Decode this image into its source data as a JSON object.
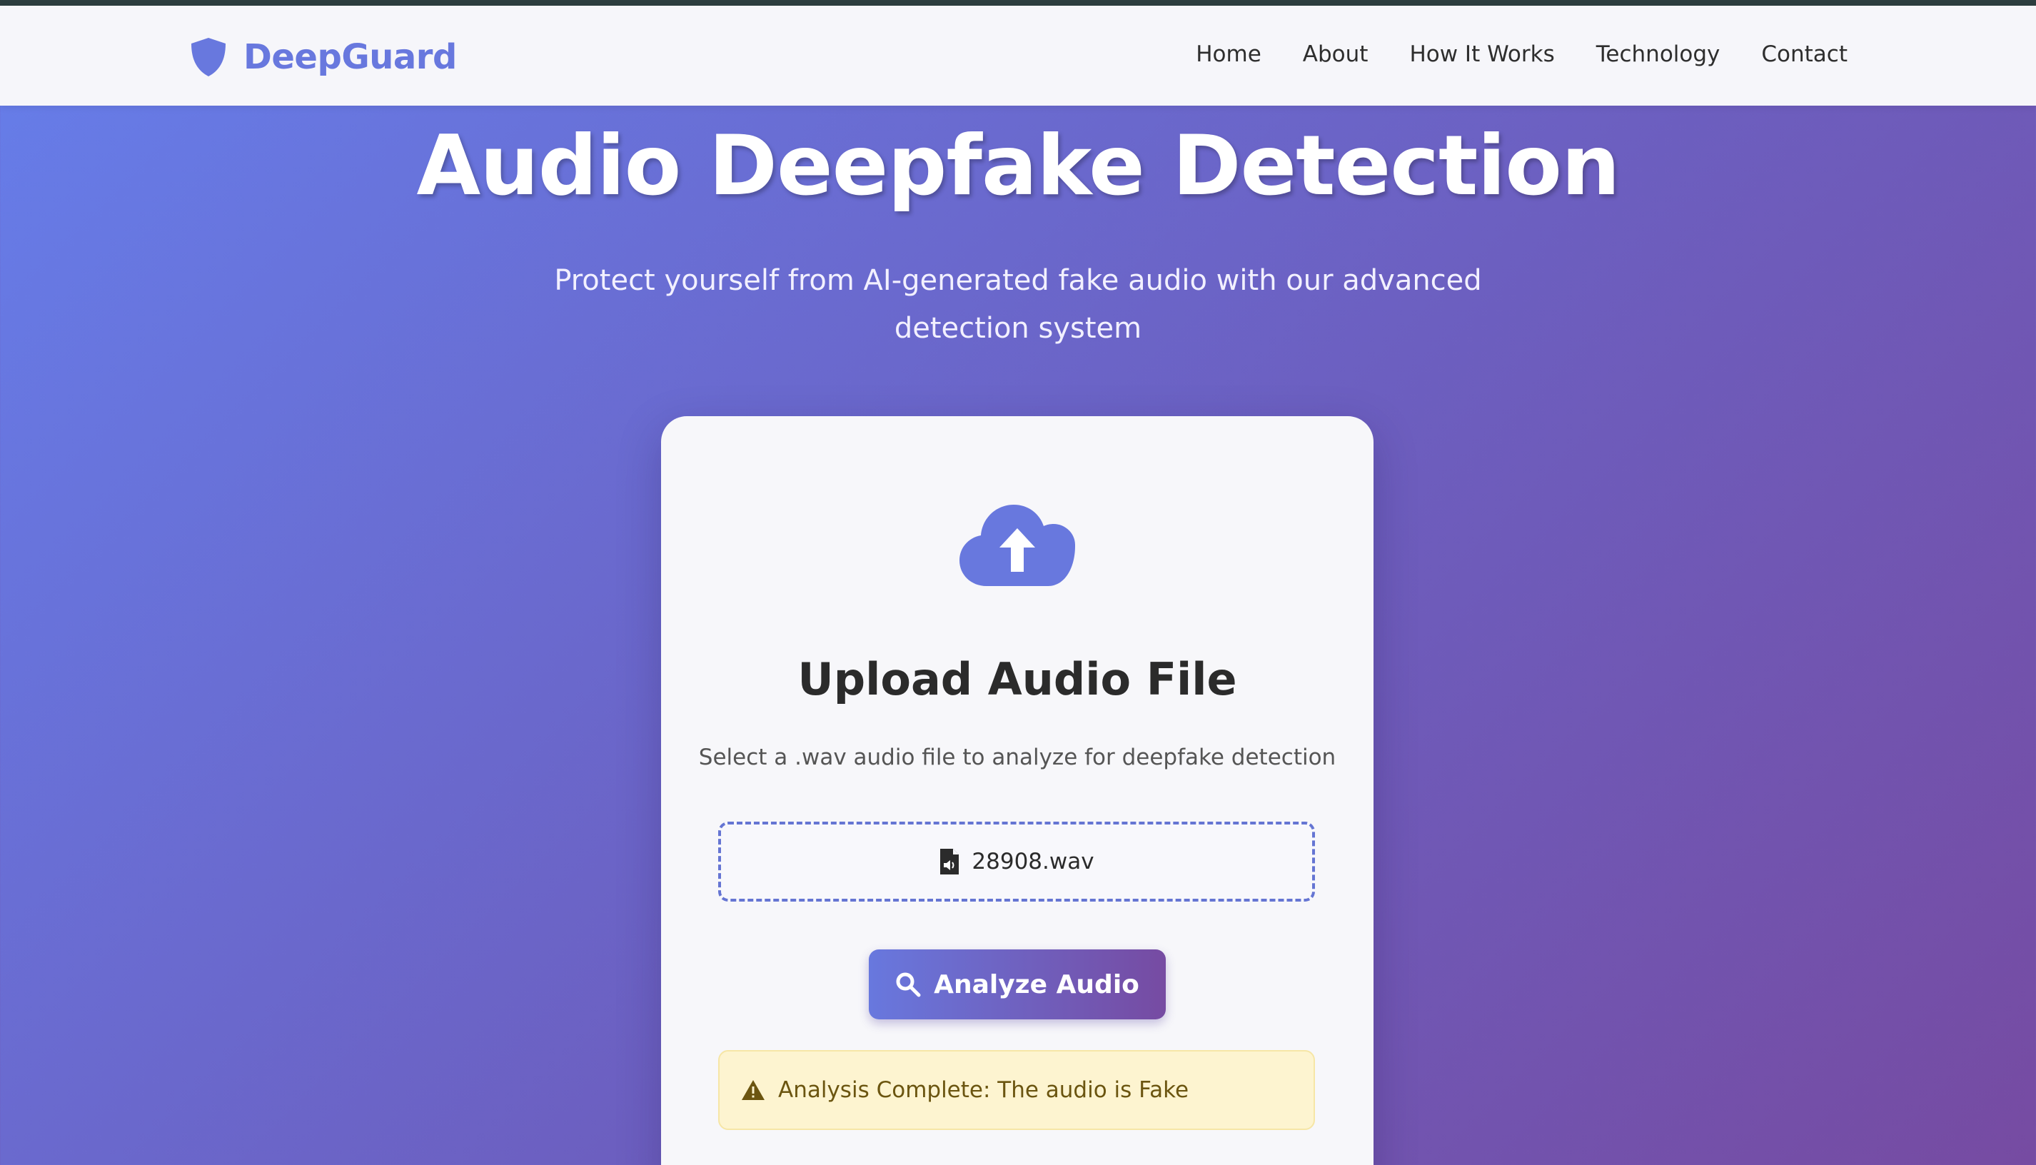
{
  "nav": {
    "brand": "DeepGuard",
    "links": [
      "Home",
      "About",
      "How It Works",
      "Technology",
      "Contact"
    ]
  },
  "hero": {
    "title": "Audio Deepfake Detection",
    "subtitle": "Protect yourself from AI-generated fake audio with our advanced detection system"
  },
  "upload": {
    "title": "Upload Audio File",
    "description": "Select a .wav audio file to analyze for deepfake detection",
    "file_name": "28908.wav",
    "button_label": "Analyze Audio",
    "result": "Analysis Complete: The audio is Fake"
  },
  "icons": {
    "brand": "shield-icon",
    "upload": "cloud-upload-icon",
    "file": "audio-file-icon",
    "button": "search-icon",
    "alert": "warning-icon"
  },
  "colors": {
    "accent": "#6878de",
    "gradient_start": "#667eea",
    "gradient_end": "#764ba2",
    "alert_bg": "#fdf4d0",
    "alert_text": "#6b5510"
  }
}
